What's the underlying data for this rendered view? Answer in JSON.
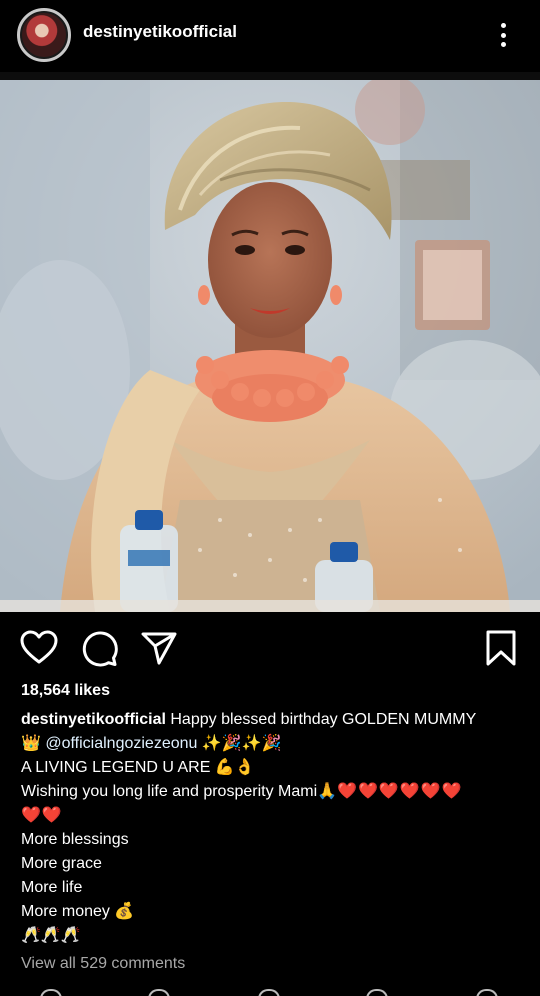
{
  "post": {
    "username": "destinyetikoofficial",
    "likes": "18,564 likes",
    "caption_lines": [
      "Happy blessed birthday GOLDEN MUMMY",
      "👑 @officialngoziezeonu ✨🎉✨🎉",
      "A LIVING LEGEND U ARE 💪👌",
      "Wishing you long life and prosperity Mami🙏",
      "❤️❤️❤️❤️❤️❤️",
      "❤️❤️",
      "More blessings",
      "More grace",
      "More life",
      "More money 💰",
      "🥂🥂🥂"
    ],
    "view_comments": "View all 529 comments"
  },
  "icons": {
    "menu": "more-vertical-icon",
    "like": "heart-icon",
    "comment": "comment-icon",
    "share": "send-icon",
    "save": "bookmark-icon"
  },
  "colors": {
    "background": "#000000",
    "text": "#ffffff",
    "muted": "#a8a8a8",
    "heart_emoji": "#e0245e"
  }
}
